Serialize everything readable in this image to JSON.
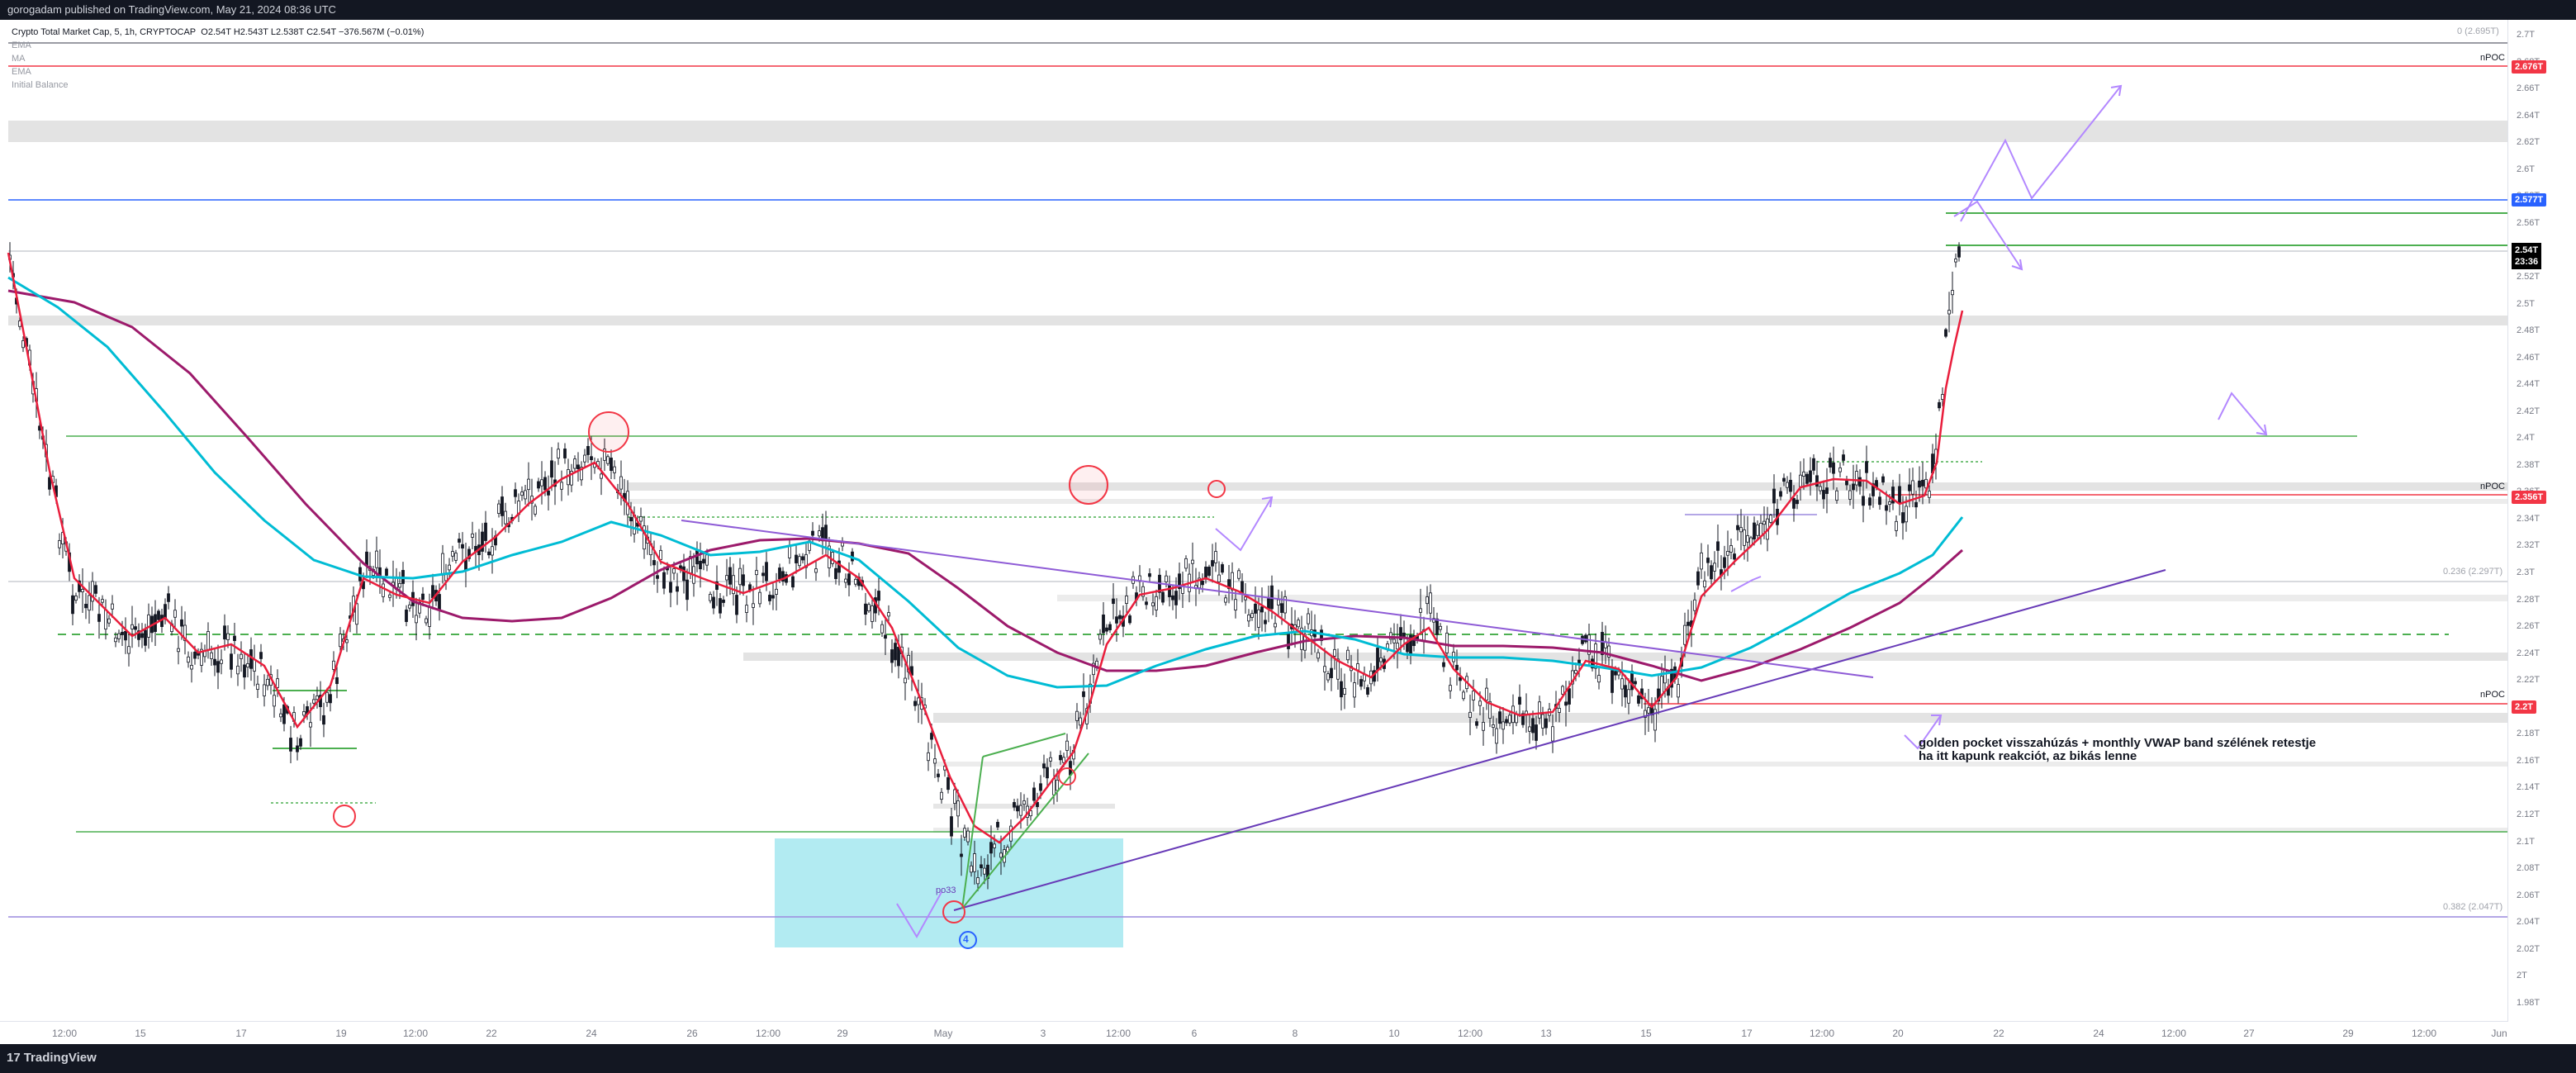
{
  "header": {
    "published_text": "gorogadam published on TradingView.com, May 21, 2024 08:36 UTC"
  },
  "legend": {
    "symbol": "Crypto Total Market Cap, 5, 1h, CRYPTOCAP",
    "ohlc": "O2.54T H2.543T L2.538T C2.54T −376.567M (−0.01%)",
    "indicators": [
      "EMA",
      "MA",
      "EMA",
      "Initial Balance"
    ]
  },
  "price_axis": {
    "ticks": [
      "2.7T",
      "2.68T",
      "2.66T",
      "2.64T",
      "2.62T",
      "2.6T",
      "2.58T",
      "2.56T",
      "2.54T",
      "2.52T",
      "2.5T",
      "2.48T",
      "2.46T",
      "2.44T",
      "2.42T",
      "2.4T",
      "2.38T",
      "2.36T",
      "2.34T",
      "2.32T",
      "2.3T",
      "2.28T",
      "2.26T",
      "2.24T",
      "2.22T",
      "2.2T",
      "2.18T",
      "2.16T",
      "2.14T",
      "2.12T",
      "2.1T",
      "2.08T",
      "2.06T",
      "2.04T",
      "2.02T",
      "2T",
      "1.98T"
    ],
    "last_price": "2.54T",
    "countdown": "23:36",
    "badges": [
      {
        "label": "2.676T",
        "color": "#f23645",
        "value": 2.676
      },
      {
        "label": "2.577T",
        "color": "#2962ff",
        "value": 2.577
      },
      {
        "label": "2.356T",
        "color": "#f23645",
        "value": 2.356
      },
      {
        "label": "2.2T",
        "color": "#f23645",
        "value": 2.2
      }
    ]
  },
  "time_axis": {
    "ticks": [
      "12:00",
      "15",
      "17",
      "19",
      "12:00",
      "22",
      "24",
      "26",
      "12:00",
      "29",
      "May",
      "3",
      "12:00",
      "6",
      "8",
      "10",
      "12:00",
      "13",
      "15",
      "17",
      "12:00",
      "20",
      "22",
      "24",
      "12:00",
      "27",
      "29",
      "12:00",
      "Jun"
    ]
  },
  "annotations": {
    "npoc_labels": [
      "nPOC",
      "nPOC",
      "nPOC"
    ],
    "fib_top": "0 (2.695T)",
    "fib_mid": "0.236 (2.297T)",
    "fib_low": "0.382 (2.047T)",
    "wave_label": "4",
    "small_label": "po33",
    "note_lines": [
      "golden pocket visszahúzás + monthly VWAP band szélének retestje",
      "ha itt kapunk reakciót, az bikás lenne"
    ]
  },
  "footer": {
    "brand": "TradingView"
  },
  "colors": {
    "red_level": "#f23645",
    "blue_level": "#2962ff",
    "green_level": "#4caf50",
    "ema_fast": "#e91e3c",
    "ema_mid": "#00bcd4",
    "ema_slow": "#9c1a6b",
    "trendline": "#673ab7",
    "zone": "#b2ebf2",
    "arrow": "#b388ff"
  }
}
